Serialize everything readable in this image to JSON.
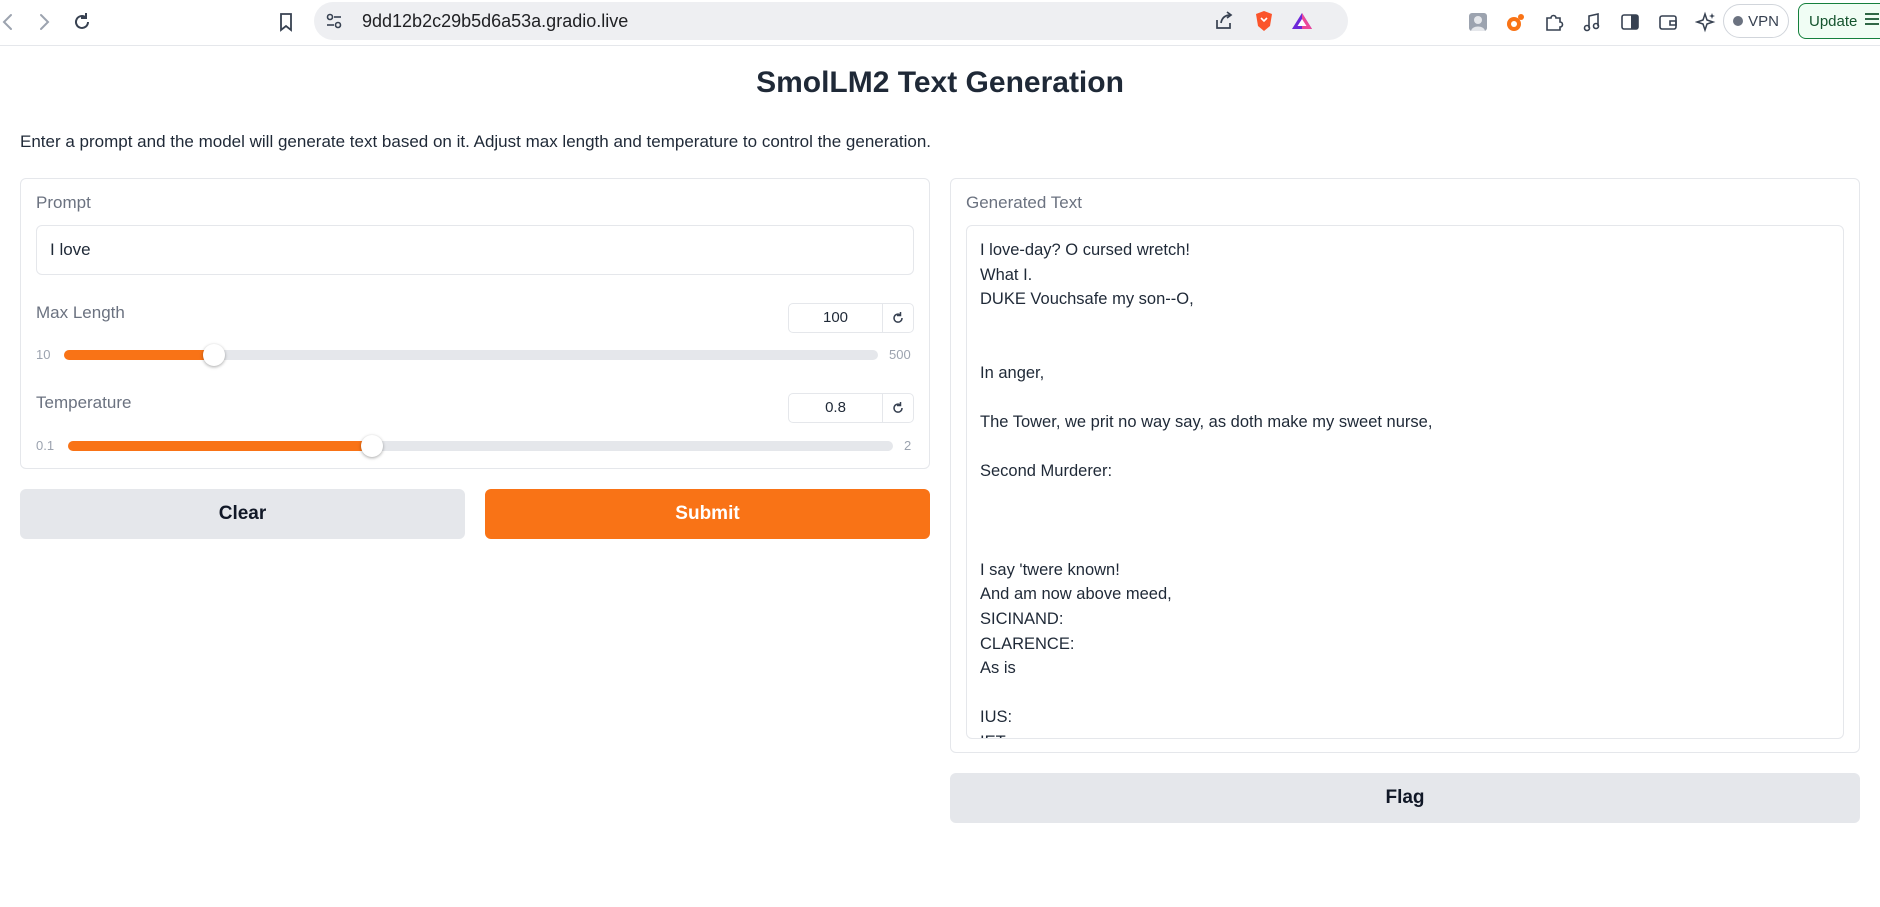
{
  "browser": {
    "url": "9dd12b2c29b5d6a53a.gradio.live",
    "vpn_label": "VPN",
    "update_label": "Update"
  },
  "page": {
    "title": "SmolLM2 Text Generation",
    "description": "Enter a prompt and the model will generate text based on it. Adjust max length and temperature to control the generation."
  },
  "inputs": {
    "prompt": {
      "label": "Prompt",
      "value": "I love"
    },
    "max_length": {
      "label": "Max Length",
      "value": "100",
      "min": "10",
      "max": "500",
      "fraction": 0.1837
    },
    "temperature": {
      "label": "Temperature",
      "value": "0.8",
      "min": "0.1",
      "max": "2",
      "fraction": 0.3684
    }
  },
  "buttons": {
    "clear": "Clear",
    "submit": "Submit",
    "flag": "Flag"
  },
  "output": {
    "label": "Generated Text",
    "lines": [
      "I love-day? O cursed wretch!",
      "What I.",
      "DUKE Vouchsafe my son--O,",
      "",
      "",
      "In anger,",
      "",
      "The Tower, we prit no way say, as doth make my sweet nurse,",
      "",
      "Second Murderer:",
      "",
      "",
      "",
      "I say 'twere known!",
      "And am now above meed,",
      "SICINAND:",
      "CLARENCE:",
      "As is",
      "",
      "IUS:",
      "IET:"
    ]
  },
  "colors": {
    "accent": "#f97316",
    "secondary_button": "#e5e7eb"
  }
}
